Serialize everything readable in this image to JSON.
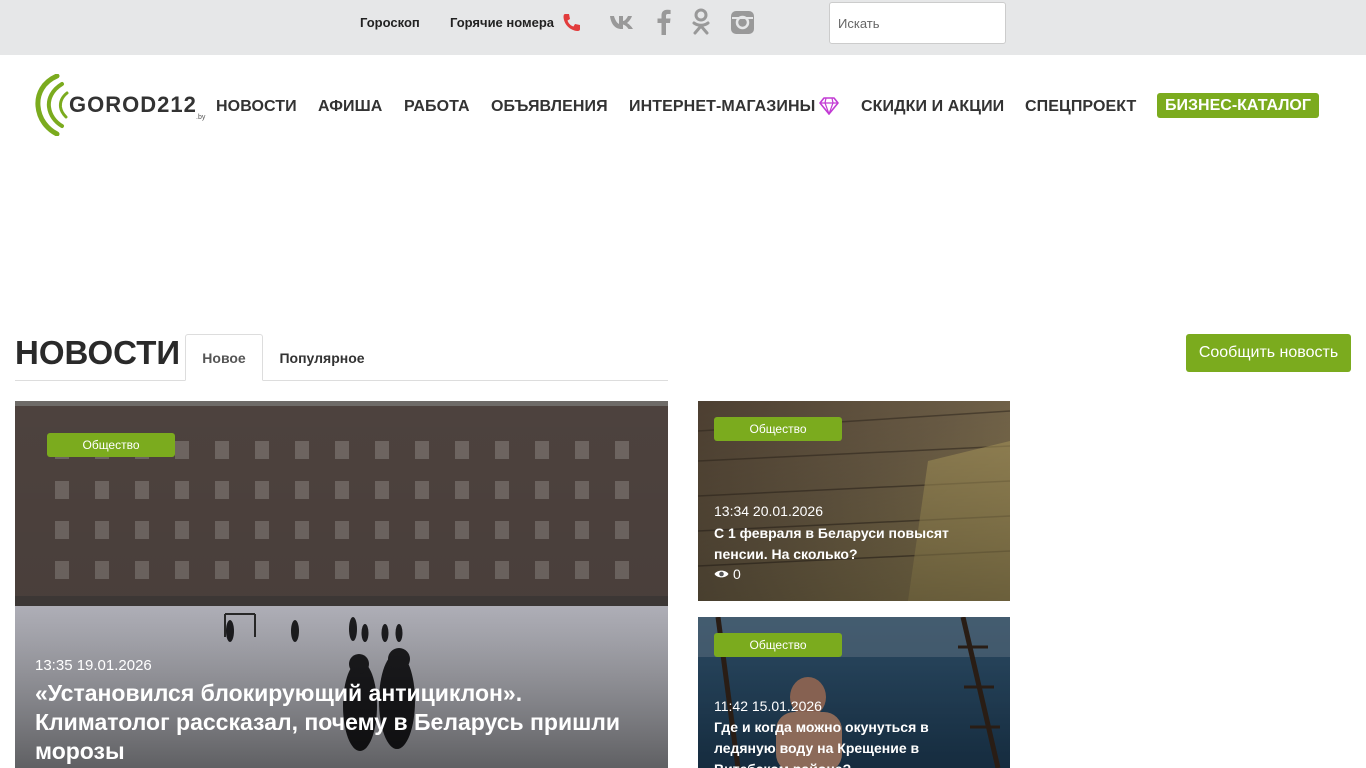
{
  "topbar": {
    "horoscope": "Гороскоп",
    "hotlines": "Горячие номера",
    "search_placeholder": "Искать"
  },
  "logo": {
    "text": "GOROD212",
    "suffix": ".by"
  },
  "nav": {
    "items": [
      "НОВОСТИ",
      "АФИША",
      "РАБОТА",
      "ОБЪЯВЛЕНИЯ",
      "ИНТЕРНЕТ-МАГАЗИНЫ",
      "СКИДКИ И АКЦИИ",
      "СПЕЦПРОЕКТ"
    ],
    "business_catalog": "БИЗНЕС-КАТАЛОГ"
  },
  "news_section": {
    "title": "НОВОСТИ",
    "tabs": [
      "Новое",
      "Популярное"
    ],
    "report_button": "Сообщить новость"
  },
  "cards": [
    {
      "category": "Общество",
      "time": "13:35 19.01.2026",
      "title": "«Установился блокирующий антициклон». Климатолог рассказал, почему в Беларусь пришли морозы"
    },
    {
      "category": "Общество",
      "time": "13:34 20.01.2026",
      "title": "С 1 февраля в Беларуси повысят пенсии. На сколько?",
      "views": "0"
    },
    {
      "category": "Общество",
      "time": "11:42 15.01.2026",
      "title": "Где и когда можно окунуться в ледяную воду на Крещение в Витебском районе?"
    }
  ],
  "colors": {
    "accent": "#7bab1e",
    "topbar_bg": "#e6e7e8",
    "nav_text": "#333333"
  }
}
